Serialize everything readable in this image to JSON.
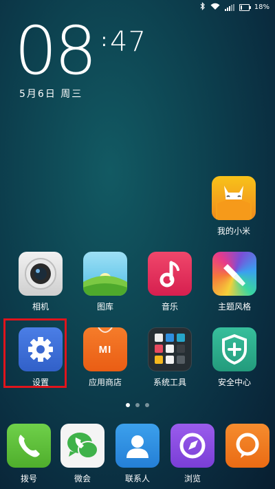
{
  "status_bar": {
    "battery_text": "18%",
    "battery_level": 0.18,
    "icons": [
      "bluetooth-icon",
      "wifi-icon",
      "signal-icon",
      "battery-icon"
    ]
  },
  "clock": {
    "hour": "08",
    "colon": ":",
    "minute": "47"
  },
  "date": "5月6日 周三",
  "apps": {
    "mi": {
      "label": "我的小米",
      "color": "#f7a21b"
    },
    "camera": {
      "label": "相机",
      "color": "#dcdcdc"
    },
    "gallery": {
      "label": "图库",
      "color": "#59c0e8"
    },
    "music": {
      "label": "音乐",
      "color": "#e8315a"
    },
    "themes": {
      "label": "主题风格",
      "color": "#7b5fd6"
    },
    "settings": {
      "label": "设置",
      "color": "#3e6fd9"
    },
    "store": {
      "label": "应用商店",
      "color": "#f06a1d",
      "logo_text": "MI"
    },
    "tools": {
      "label": "系统工具",
      "color": "#2b3338"
    },
    "security": {
      "label": "安全中心",
      "color": "#2fae8e"
    }
  },
  "dock": {
    "dialer": {
      "label": "拨号",
      "color": "#5cbb3a"
    },
    "wechat": {
      "label": "微会",
      "color": "#f2f2f2"
    },
    "contacts": {
      "label": "联系人",
      "color": "#2f8fe0"
    },
    "browser": {
      "label": "浏览",
      "color": "#8a4fe0"
    },
    "messages": {
      "label": "",
      "color": "#f07a1d"
    }
  },
  "pager": {
    "pages": 3,
    "active": 0
  }
}
